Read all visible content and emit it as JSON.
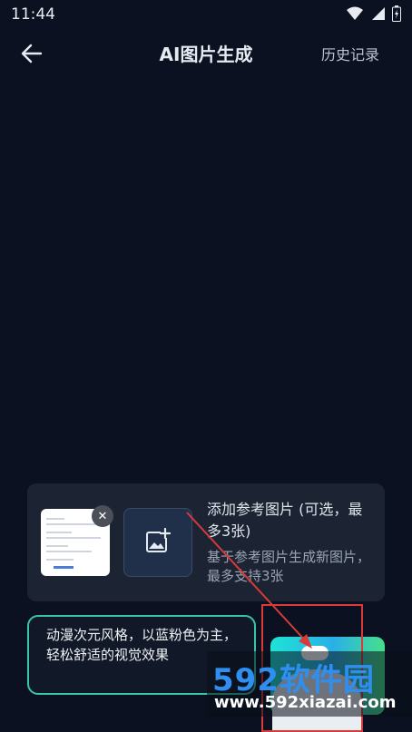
{
  "status_bar": {
    "time": "11:44",
    "icons": [
      "wifi-icon",
      "signal-icon",
      "battery-icon"
    ]
  },
  "header": {
    "title": "AI图片生成",
    "history": "历史记录"
  },
  "reference": {
    "title": "添加参考图片 (可选，最多3张)",
    "subtitle": "基于参考图片生成新图片，最多支持3张",
    "close_glyph": "✕"
  },
  "prompt": {
    "text": "动漫次元风格，以蓝粉色为主，轻松舒适的视觉效果"
  },
  "watermark": {
    "main": "592软件园",
    "url": "www.592xiazai.com"
  },
  "colors": {
    "background": "#0b1120",
    "card": "#1c2433",
    "accent_border": "#3bc5a7",
    "annotation": "#d93a3a"
  }
}
